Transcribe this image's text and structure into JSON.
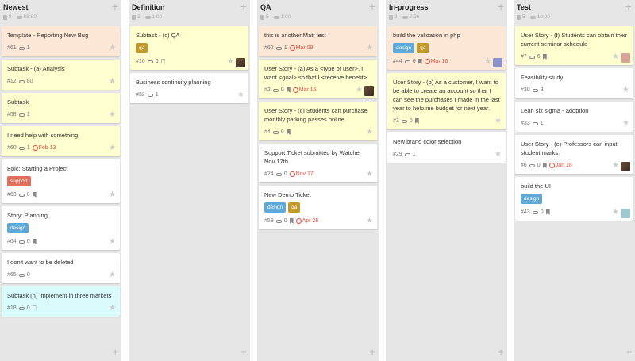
{
  "columns": [
    {
      "title": "Newest",
      "stats": {
        "count": "8",
        "time": "03:80"
      },
      "cards": [
        {
          "title": "Template - Reporting New Bug",
          "color": "peach",
          "id": "#61",
          "tags": "1",
          "flag": "",
          "due": "",
          "labels": [],
          "avatar": ""
        },
        {
          "title": "Subtask - (a) Analysis",
          "color": "yellow",
          "id": "#12",
          "tags": "80",
          "flag": "",
          "due": "",
          "labels": [],
          "avatar": ""
        },
        {
          "title": "Subtask",
          "color": "yellow",
          "id": "#58",
          "tags": "1",
          "flag": "",
          "due": "",
          "labels": [],
          "avatar": ""
        },
        {
          "title": "I need help with something",
          "color": "yellow",
          "id": "#60",
          "tags": "1",
          "flag": "",
          "due": "Feb 13",
          "labels": [],
          "avatar": ""
        },
        {
          "title": "Epic: Starting a Project",
          "color": "white",
          "id": "#63",
          "tags": "0",
          "flag": "solid",
          "due": "",
          "labels": [
            "support"
          ],
          "avatar": ""
        },
        {
          "title": "Story: Planning",
          "color": "white",
          "id": "#64",
          "tags": "0",
          "flag": "solid",
          "due": "",
          "labels": [
            "design"
          ],
          "avatar": ""
        },
        {
          "title": "I don't want to be deleted",
          "color": "white",
          "id": "#65",
          "tags": "0",
          "flag": "",
          "due": "",
          "labels": [],
          "avatar": ""
        },
        {
          "title": "Subtask (n) Implement in three markets",
          "color": "cyan",
          "id": "#18",
          "tags": "0",
          "flag": "outline",
          "due": "",
          "labels": [],
          "avatar": ""
        }
      ]
    },
    {
      "title": "Definition",
      "stats": {
        "count": "2",
        "time": "1:00"
      },
      "cards": [
        {
          "title": "Subtask - (c) QA",
          "color": "yellow",
          "id": "#10",
          "tags": "0",
          "flag": "outline",
          "due": "",
          "labels": [
            "qa"
          ],
          "avatar": "photo"
        },
        {
          "title": "Business continuity planning",
          "color": "white",
          "id": "#32",
          "tags": "1",
          "flag": "",
          "due": "",
          "labels": [],
          "avatar": ""
        }
      ]
    },
    {
      "title": "QA",
      "stats": {
        "count": "5",
        "time": "1:00"
      },
      "cards": [
        {
          "title": "this is another Matt test",
          "color": "peach",
          "id": "#62",
          "tags": "1",
          "flag": "",
          "due": "Mar 09",
          "labels": [],
          "avatar": ""
        },
        {
          "title": "User Story - (a) As a <type of user>, I want <goal> so that I <receive benefit>.",
          "color": "yellow",
          "id": "#2",
          "tags": "0",
          "flag": "solid",
          "due": "Mar 15",
          "labels": [],
          "avatar": "photo"
        },
        {
          "title": "User Story - (c) Students can purchase monthly parking passes online.",
          "color": "yellow",
          "id": "#4",
          "tags": "0",
          "flag": "solid",
          "due": "",
          "labels": [],
          "avatar": ""
        },
        {
          "title": "Support Ticket submitted by Watcher Nov 17th",
          "color": "white",
          "id": "#24",
          "tags": "0",
          "flag": "",
          "due": "Nov 17",
          "labels": [],
          "avatar": ""
        },
        {
          "title": "New Demo Ticket",
          "color": "white",
          "id": "#59",
          "tags": "0",
          "flag": "solid",
          "due": "Apr 26",
          "labels": [
            "design",
            "qa"
          ],
          "avatar": ""
        }
      ]
    },
    {
      "title": "In-progress",
      "stats": {
        "count": "3",
        "time": "7:06"
      },
      "cards": [
        {
          "title": "build the validation in php",
          "color": "peach",
          "id": "#44",
          "tags": "6",
          "flag": "solid",
          "due": "Mar 16",
          "labels": [
            "design",
            "qa"
          ],
          "avatar": "purple"
        },
        {
          "title": "User Story - (b) As a customer, I want to be able to create an account so that I can see the purchases I made in the last year to help me budget for next year.",
          "color": "yellow",
          "id": "#3",
          "tags": "0",
          "flag": "solid",
          "due": "",
          "labels": [],
          "avatar": ""
        },
        {
          "title": "New brand color selection",
          "color": "white",
          "id": "#29",
          "tags": "1",
          "flag": "",
          "due": "",
          "labels": [],
          "avatar": ""
        }
      ]
    },
    {
      "title": "Test",
      "stats": {
        "count": "5",
        "time": "10:00"
      },
      "cards": [
        {
          "title": "User Story - (f) Students can obtain their current seminar schedule",
          "color": "yellow",
          "id": "#7",
          "tags": "6",
          "flag": "solid",
          "due": "",
          "labels": [],
          "avatar": "pink"
        },
        {
          "title": "Feasibility study",
          "color": "white",
          "id": "#30",
          "tags": "3",
          "flag": "",
          "due": "",
          "labels": [],
          "avatar": ""
        },
        {
          "title": "Lean six sigma - adoption",
          "color": "white",
          "id": "#33",
          "tags": "1",
          "flag": "",
          "due": "",
          "labels": [],
          "avatar": ""
        },
        {
          "title": "User Story - (e) Professors can input student marks.",
          "color": "white",
          "id": "#6",
          "tags": "0",
          "flag": "solid",
          "due": "Jan 18",
          "labels": [],
          "avatar": "photo"
        },
        {
          "title": "build the UI",
          "color": "white",
          "id": "#43",
          "tags": "0",
          "flag": "solid",
          "due": "",
          "labels": [
            "design"
          ],
          "avatar": "teal"
        }
      ]
    }
  ],
  "icons": {
    "add": "plus-icon",
    "star": "star-icon",
    "tag": "tag-icon",
    "flag": "flag-icon",
    "clock": "clock-icon"
  },
  "colors": {
    "peach": "#fde7d6",
    "yellow": "#ffffcf",
    "cyan": "#d9fbfb",
    "due": "#e74c3c",
    "design_label": "#5fa9d8",
    "qa_label": "#c29a2a",
    "support_label": "#e36e5b"
  }
}
